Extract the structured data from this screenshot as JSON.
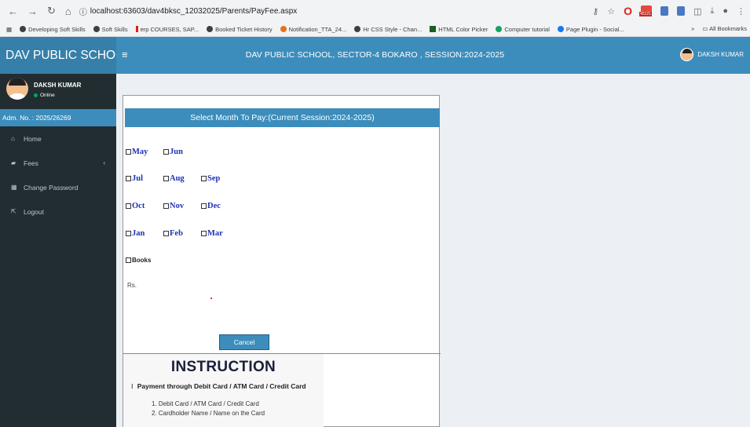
{
  "browser": {
    "url": "localhost:63603/dav4bksc_12032025/Parents/PayFee.aspx",
    "extension_badge": "45121",
    "bookmarks": [
      "Developing Soft Skills",
      "Soft Skills",
      "erp COURSES, SAP...",
      "Booked Ticket History",
      "Notification_TTA_24...",
      "Hr CSS Style - Chan...",
      "HTML Color Picker",
      "Computer tutorial",
      "Page Plugin - Social..."
    ],
    "all_bookmarks": "All Bookmarks",
    "more": "»"
  },
  "header": {
    "logo": "DAV PUBLIC SCHOOL",
    "title": "DAV PUBLIC SCHOOL, SECTOR-4 BOKARO , SESSION:2024-2025",
    "user": "DAKSH KUMAR"
  },
  "sidebar": {
    "user_name": "DAKSH KUMAR",
    "status": "Online",
    "adm_no": "Adm. No. : 2025/26269",
    "items": [
      {
        "label": "Home",
        "icon": "home-icon"
      },
      {
        "label": "Fees",
        "icon": "fees-icon"
      },
      {
        "label": "Change Password",
        "icon": "table-icon"
      },
      {
        "label": "Logout",
        "icon": "logout-icon"
      }
    ]
  },
  "form": {
    "title": "Select Month To Pay:(Current Session:2024-2025)",
    "months": [
      [
        "May",
        "Jun"
      ],
      [
        "Jul",
        "Aug",
        "Sep"
      ],
      [
        "Oct",
        "Nov",
        "Dec"
      ],
      [
        "Jan",
        "Feb",
        "Mar"
      ]
    ],
    "books": "Books",
    "rs": "Rs.",
    "cancel": "Cancel"
  },
  "instruction": {
    "title": "INSTRUCTION",
    "subtitle": "Payment through Debit Card / ATM Card / Credit Card",
    "list": [
      "1. Debit Card / ATM Card / Credit Card",
      "2. Cardholder Name / Name on the Card"
    ]
  }
}
